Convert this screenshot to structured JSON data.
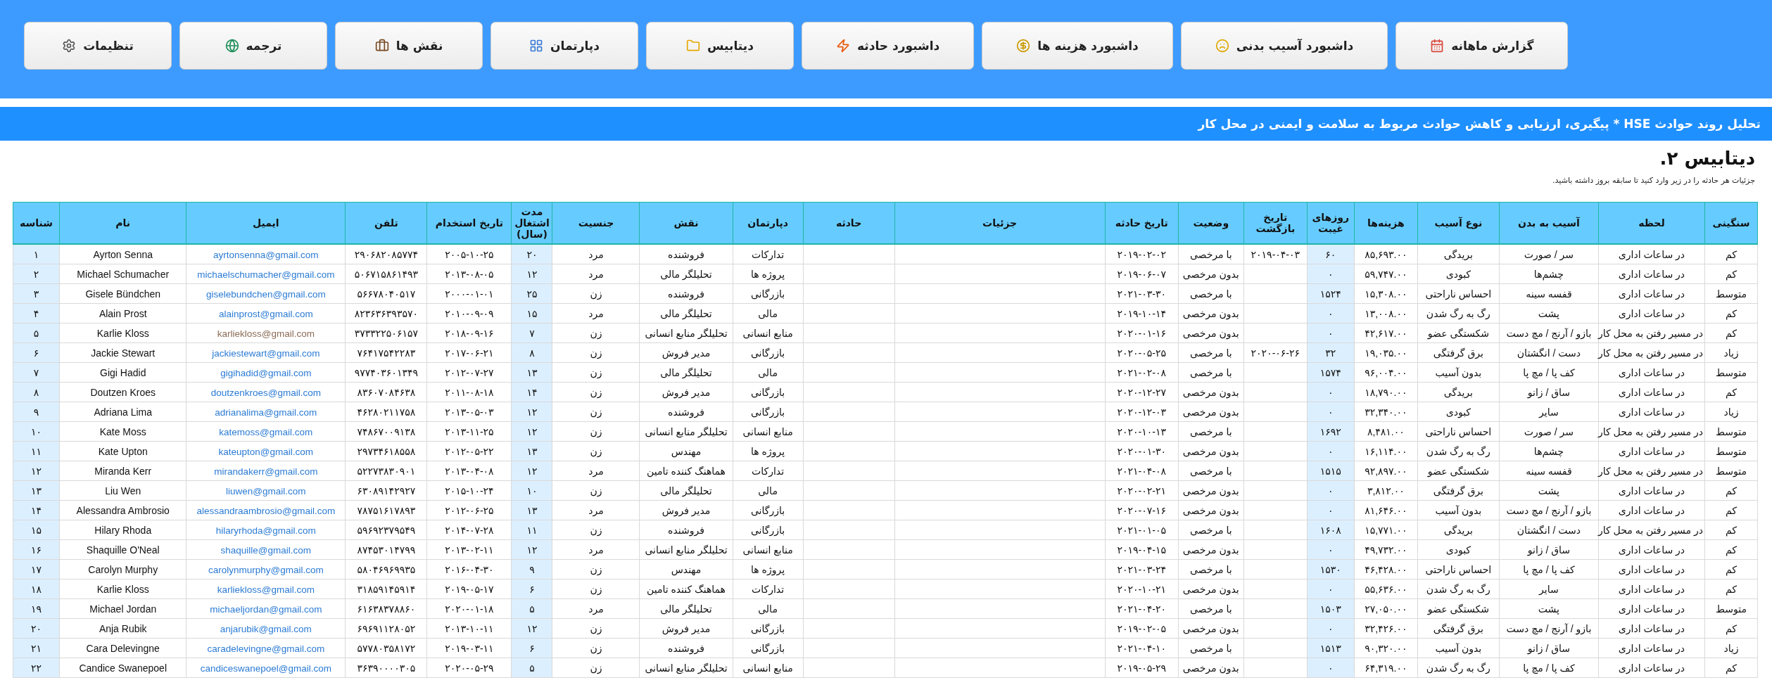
{
  "nav": [
    {
      "label": "گزارش ماهانه",
      "kind": "calendar"
    },
    {
      "label": "داشبورد آسیب بدنی",
      "kind": "sad"
    },
    {
      "label": "داشبورد هزینه ها",
      "kind": "money"
    },
    {
      "label": "داشبورد حادثه",
      "kind": "burst"
    },
    {
      "label": "دیتابیس",
      "kind": "folder"
    },
    {
      "label": "دپارتمان",
      "kind": "grid"
    },
    {
      "label": "نقش ها",
      "kind": "briefcase"
    },
    {
      "label": "ترجمه",
      "kind": "globe"
    },
    {
      "label": "تنظیمات",
      "kind": "gear"
    }
  ],
  "banner": "تحلیل روند حوادث HSE * پیگیری، ارزیابی و کاهش حوادث مربوط به سلامت و ایمنی در محل کار",
  "title": "دیتابیس ۲.",
  "subtitle": "جزئیات هر حادثه را در زیر وارد کنید تا سابقه بروز داشته باشید.",
  "table": {
    "columns": [
      {
        "label": "سنگینی"
      },
      {
        "label": "لحظه"
      },
      {
        "label": "آسیب به بدن"
      },
      {
        "label": "نوع آسیب"
      },
      {
        "label": "هزینه‌ها"
      },
      {
        "label": "روزهای غیبت"
      },
      {
        "label": "تاریخ بازگشت"
      },
      {
        "label": "وضعیت"
      },
      {
        "label": "تاریخ حادثه"
      },
      {
        "label": "جزئیات"
      },
      {
        "label": "حادثه"
      },
      {
        "label": "دپارتمان"
      },
      {
        "label": "نقش"
      },
      {
        "label": "جنسیت"
      },
      {
        "label": "مدت اشتغال (سال)"
      },
      {
        "label": "تاریخ استخدام"
      },
      {
        "label": "تلفن"
      },
      {
        "label": "ایمیل"
      },
      {
        "label": "نام"
      },
      {
        "label": "شناسه"
      }
    ],
    "rows": [
      {
        "severity": "کم",
        "moment": "در ساعات اداری",
        "body_part": "سر / صورت",
        "injury_type": "بریدگی",
        "cost": "۸۵,۶۹۳.۰۰",
        "days_absent": "۶۰",
        "return_date": "۲۰۱۹-۰۴-۰۳",
        "status": "با مرخصی",
        "incident_date": "۲۰۱۹-۰۲-۰۲",
        "department": "تدارکات",
        "role": "فروشنده",
        "gender": "مرد",
        "years": "۲۰",
        "hire_date": "۲۰۰۵-۱۰-۲۵",
        "phone": "۲۹۰۶۸۲۰۸۵۷۷۴",
        "email": "ayrtonsenna@gmail.com",
        "email_visited": false,
        "name": "Ayrton Senna",
        "id": "۱"
      },
      {
        "severity": "کم",
        "moment": "در ساعات اداری",
        "body_part": "چشم‌ها",
        "injury_type": "کبودی",
        "cost": "۵۹,۷۴۷.۰۰",
        "days_absent": "۰",
        "status": "بدون مرخصی",
        "incident_date": "۲۰۱۹-۰۶-۰۷",
        "department": "پروژه ها",
        "role": "تحلیلگر مالی",
        "gender": "مرد",
        "years": "۱۲",
        "hire_date": "۲۰۱۳-۰۸-۰۵",
        "phone": "۵۰۶۷۱۵۸۶۱۴۹۳",
        "email": "michaelschumacher@gmail.com",
        "email_visited": false,
        "name": "Michael Schumacher",
        "id": "۲"
      },
      {
        "severity": "متوسط",
        "moment": "در ساعات اداری",
        "body_part": "قفسه سینه",
        "injury_type": "احساس ناراحتی",
        "cost": "۱۵,۳۰۸.۰۰",
        "days_absent": "۱۵۲۴",
        "status": "با مرخصی",
        "incident_date": "۲۰۲۱-۰۳-۳۰",
        "department": "بازرگانی",
        "role": "فروشنده",
        "gender": "زن",
        "years": "۲۵",
        "hire_date": "۲۰۰۰-۰۱-۰۱",
        "phone": "۵۶۶۷۸۰۴۰۵۱۷",
        "email": "giselebundchen@gmail.com",
        "email_visited": false,
        "name": "Gisele Bündchen",
        "id": "۳"
      },
      {
        "severity": "کم",
        "moment": "در ساعات اداری",
        "body_part": "پشت",
        "injury_type": "رگ به رگ شدن",
        "cost": "۱۳,۰۰۸.۰۰",
        "days_absent": "۰",
        "status": "بدون مرخصی",
        "incident_date": "۲۰۱۹-۱۰-۱۴",
        "department": "مالی",
        "role": "تحلیلگر مالی",
        "gender": "مرد",
        "years": "۱۵",
        "hire_date": "۲۰۱۰-۰۹-۰۹",
        "phone": "۸۲۳۶۳۶۳۹۳۵۷۰",
        "email": "alainprost@gmail.com",
        "email_visited": false,
        "name": "Alain Prost",
        "id": "۴"
      },
      {
        "severity": "کم",
        "moment": "در مسیر رفتن به محل کار",
        "body_part": "بازو / آرنج / مچ دست",
        "injury_type": "شکستگی عضو",
        "cost": "۴۲,۶۱۷.۰۰",
        "days_absent": "۰",
        "status": "بدون مرخصی",
        "incident_date": "۲۰۲۰-۰۱-۱۶",
        "department": "منابع انسانی",
        "role": "تحلیلگر منابع انسانی",
        "gender": "زن",
        "years": "۷",
        "hire_date": "۲۰۱۸-۰۹-۱۶",
        "phone": "۳۷۳۳۲۲۵۰۶۱۵۷",
        "email": "karliekloss@gmail.com",
        "email_visited": true,
        "name": "Karlie Kloss",
        "id": "۵"
      },
      {
        "severity": "زیاد",
        "moment": "در مسیر رفتن به محل کار",
        "body_part": "دست / انگشتان",
        "injury_type": "برق گرفتگی",
        "cost": "۱۹,۰۳۵.۰۰",
        "days_absent": "۳۲",
        "return_date": "۲۰۲۰-۰۶-۲۶",
        "status": "با مرخصی",
        "incident_date": "۲۰۲۰-۰۵-۲۵",
        "department": "بازرگانی",
        "role": "مدیر فروش",
        "gender": "زن",
        "years": "۸",
        "hire_date": "۲۰۱۷-۰۶-۲۱",
        "phone": "۷۶۴۱۷۵۴۲۲۸۳",
        "email": "jackiestewart@gmail.com",
        "email_visited": false,
        "name": "Jackie Stewart",
        "id": "۶"
      },
      {
        "severity": "متوسط",
        "moment": "در ساعات اداری",
        "body_part": "کف پا / مچ پا",
        "injury_type": "بدون آسیب",
        "cost": "۹۶,۰۰۴.۰۰",
        "days_absent": "۱۵۷۴",
        "status": "با مرخصی",
        "incident_date": "۲۰۲۱-۰۲-۰۸",
        "department": "مالی",
        "role": "تحلیلگر مالی",
        "gender": "زن",
        "years": "۱۳",
        "hire_date": "۲۰۱۲-۰۷-۲۷",
        "phone": "۹۷۷۴۰۳۶۰۱۳۴۹",
        "email": "gigihadid@gmail.com",
        "email_visited": false,
        "name": "Gigi Hadid",
        "id": "۷"
      },
      {
        "severity": "کم",
        "moment": "در ساعات اداری",
        "body_part": "ساق / زانو",
        "injury_type": "بریدگی",
        "cost": "۱۸,۷۹۰.۰۰",
        "days_absent": "۰",
        "status": "بدون مرخصی",
        "incident_date": "۲۰۲۰-۱۲-۲۷",
        "department": "بازرگانی",
        "role": "مدیر فروش",
        "gender": "زن",
        "years": "۱۴",
        "hire_date": "۲۰۱۱-۰۸-۱۸",
        "phone": "۸۳۶۰۷۰۸۴۶۳۸",
        "email": "doutzenkroes@gmail.com",
        "email_visited": false,
        "name": "Doutzen Kroes",
        "id": "۸"
      },
      {
        "severity": "زیاد",
        "moment": "در ساعات اداری",
        "body_part": "سایر",
        "injury_type": "کبودی",
        "cost": "۳۲,۳۴۰.۰۰",
        "days_absent": "۰",
        "status": "بدون مرخصی",
        "incident_date": "۲۰۲۰-۱۲-۰۳",
        "department": "بازرگانی",
        "role": "فروشنده",
        "gender": "زن",
        "years": "۱۲",
        "hire_date": "۲۰۱۳-۰۵-۰۳",
        "phone": "۴۶۲۸۰۲۱۱۷۵۸",
        "email": "adrianalima@gmail.com",
        "email_visited": false,
        "name": "Adriana Lima",
        "id": "۹"
      },
      {
        "severity": "متوسط",
        "moment": "در مسیر رفتن به محل کار",
        "body_part": "سر / صورت",
        "injury_type": "احساس ناراحتی",
        "cost": "۸,۴۸۱.۰۰",
        "days_absent": "۱۶۹۲",
        "status": "با مرخصی",
        "incident_date": "۲۰۲۰-۱۰-۱۳",
        "department": "منابع انسانی",
        "role": "تحلیلگر منابع انسانی",
        "gender": "زن",
        "years": "۱۲",
        "hire_date": "۲۰۱۳-۱۱-۲۵",
        "phone": "۷۴۸۶۷۰۰۹۱۳۸",
        "email": "katemoss@gmail.com",
        "email_visited": false,
        "name": "Kate Moss",
        "id": "۱۰"
      },
      {
        "severity": "متوسط",
        "moment": "در ساعات اداری",
        "body_part": "چشم‌ها",
        "injury_type": "رگ به رگ شدن",
        "cost": "۱۶,۱۱۴.۰۰",
        "days_absent": "۰",
        "status": "بدون مرخصی",
        "incident_date": "۲۰۲۰-۰۱-۳۰",
        "department": "پروژه ها",
        "role": "مهندس",
        "gender": "زن",
        "years": "۱۳",
        "hire_date": "۲۰۱۲-۰۵-۲۲",
        "phone": "۲۹۷۳۴۶۱۸۵۵۸",
        "email": "kateupton@gmail.com",
        "email_visited": false,
        "name": "Kate Upton",
        "id": "۱۱"
      },
      {
        "severity": "متوسط",
        "moment": "در مسیر رفتن به محل کار",
        "body_part": "قفسه سینه",
        "injury_type": "شکستگی عضو",
        "cost": "۹۲,۸۹۷.۰۰",
        "days_absent": "۱۵۱۵",
        "status": "با مرخصی",
        "incident_date": "۲۰۲۱-۰۴-۰۸",
        "department": "تدارکات",
        "role": "هماهنگ کننده تامین",
        "gender": "مرد",
        "years": "۱۲",
        "hire_date": "۲۰۱۳-۰۴-۰۸",
        "phone": "۵۲۲۷۳۸۳۰۹۰۱",
        "email": "mirandakerr@gmail.com",
        "email_visited": false,
        "name": "Miranda Kerr",
        "id": "۱۲"
      },
      {
        "severity": "کم",
        "moment": "در ساعات اداری",
        "body_part": "پشت",
        "injury_type": "برق گرفتگی",
        "cost": "۳,۸۱۲.۰۰",
        "days_absent": "۰",
        "status": "بدون مرخصی",
        "incident_date": "۲۰۲۰-۰۲-۲۱",
        "department": "مالی",
        "role": "تحلیلگر مالی",
        "gender": "زن",
        "years": "۱۰",
        "hire_date": "۲۰۱۵-۱۰-۲۴",
        "phone": "۶۳۰۸۹۱۴۲۹۲۷",
        "email": "liuwen@gmail.com",
        "email_visited": false,
        "name": "Liu Wen",
        "id": "۱۳"
      },
      {
        "severity": "کم",
        "moment": "در ساعات اداری",
        "body_part": "بازو / آرنج / مچ دست",
        "injury_type": "بدون آسیب",
        "cost": "۸۱,۶۴۶.۰۰",
        "days_absent": "۰",
        "status": "بدون مرخصی",
        "incident_date": "۲۰۲۰-۰۷-۱۶",
        "department": "بازرگانی",
        "role": "مدیر فروش",
        "gender": "مرد",
        "years": "۱۳",
        "hire_date": "۲۰۱۲-۰۶-۲۵",
        "phone": "۷۸۷۵۱۶۱۷۸۹۳",
        "email": "alessandraambrosio@gmail.com",
        "email_visited": false,
        "name": "Alessandra Ambrosio",
        "id": "۱۴"
      },
      {
        "severity": "کم",
        "moment": "در مسیر رفتن به محل کار",
        "body_part": "دست / انگشتان",
        "injury_type": "بریدگی",
        "cost": "۱۵,۷۷۱.۰۰",
        "days_absent": "۱۶۰۸",
        "status": "با مرخصی",
        "incident_date": "۲۰۲۱-۰۱-۰۵",
        "department": "بازرگانی",
        "role": "فروشنده",
        "gender": "زن",
        "years": "۱۱",
        "hire_date": "۲۰۱۴-۰۷-۲۸",
        "phone": "۵۹۶۹۲۳۷۹۵۴۹",
        "email": "hilaryrhoda@gmail.com",
        "email_visited": false,
        "name": "Hilary Rhoda",
        "id": "۱۵"
      },
      {
        "severity": "کم",
        "moment": "در ساعات اداری",
        "body_part": "ساق / زانو",
        "injury_type": "کبودی",
        "cost": "۴۹,۷۳۲.۰۰",
        "days_absent": "۰",
        "status": "بدون مرخصی",
        "incident_date": "۲۰۱۹-۰۴-۱۵",
        "department": "منابع انسانی",
        "role": "تحلیلگر منابع انسانی",
        "gender": "مرد",
        "years": "۱۲",
        "hire_date": "۲۰۱۳-۰۲-۱۱",
        "phone": "۸۷۴۵۳۰۱۴۷۹۹",
        "email": "shaquille@gmail.com",
        "email_visited": false,
        "name": "Shaquille O'Neal",
        "id": "۱۶"
      },
      {
        "severity": "کم",
        "moment": "در ساعات اداری",
        "body_part": "کف پا / مچ پا",
        "injury_type": "احساس ناراحتی",
        "cost": "۴۶,۴۲۸.۰۰",
        "days_absent": "۱۵۳۰",
        "status": "با مرخصی",
        "incident_date": "۲۰۲۱-۰۳-۲۴",
        "department": "پروژه ها",
        "role": "مهندس",
        "gender": "زن",
        "years": "۹",
        "hire_date": "۲۰۱۶-۰۴-۳۰",
        "phone": "۵۸۰۴۶۹۶۹۹۳۵",
        "email": "carolynmurphy@gmail.com",
        "email_visited": false,
        "name": "Carolyn Murphy",
        "id": "۱۷"
      },
      {
        "severity": "کم",
        "moment": "در ساعات اداری",
        "body_part": "سایر",
        "injury_type": "رگ به رگ شدن",
        "cost": "۵۵,۶۳۶.۰۰",
        "days_absent": "۰",
        "status": "بدون مرخصی",
        "incident_date": "۲۰۲۰-۱۰-۲۱",
        "department": "تدارکات",
        "role": "هماهنگ کننده تامین",
        "gender": "زن",
        "years": "۶",
        "hire_date": "۲۰۱۹-۰۵-۱۷",
        "phone": "۳۱۸۵۹۱۴۵۹۱۴",
        "email": "karliekloss@gmail.com",
        "email_visited": false,
        "name": "Karlie Kloss",
        "id": "۱۸"
      },
      {
        "severity": "متوسط",
        "moment": "در ساعات اداری",
        "body_part": "پشت",
        "injury_type": "شکستگی عضو",
        "cost": "۲۷,۰۵۰.۰۰",
        "days_absent": "۱۵۰۳",
        "status": "با مرخصی",
        "incident_date": "۲۰۲۱-۰۴-۲۰",
        "department": "مالی",
        "role": "تحلیلگر مالی",
        "gender": "مرد",
        "years": "۵",
        "hire_date": "۲۰۲۰-۰۱-۱۸",
        "phone": "۶۱۶۳۸۳۷۸۸۶۰",
        "email": "michaeljordan@gmail.com",
        "email_visited": false,
        "name": "Michael Jordan",
        "id": "۱۹"
      },
      {
        "severity": "کم",
        "moment": "در ساعات اداری",
        "body_part": "بازو / آرنج / مچ دست",
        "injury_type": "برق گرفتگی",
        "cost": "۳۲,۴۲۶.۰۰",
        "days_absent": "۰",
        "status": "بدون مرخصی",
        "incident_date": "۲۰۱۹-۰۲-۰۵",
        "department": "بازرگانی",
        "role": "مدیر فروش",
        "gender": "زن",
        "years": "۱۲",
        "hire_date": "۲۰۱۳-۱۰-۱۱",
        "phone": "۶۹۶۹۱۱۲۸۰۵۲",
        "email": "anjarubik@gmail.com",
        "email_visited": false,
        "name": "Anja Rubik",
        "id": "۲۰"
      },
      {
        "severity": "زیاد",
        "moment": "در ساعات اداری",
        "body_part": "ساق / زانو",
        "injury_type": "بدون آسیب",
        "cost": "۹۰,۳۲۰.۰۰",
        "days_absent": "۱۵۱۳",
        "status": "با مرخصی",
        "incident_date": "۲۰۲۱-۰۴-۱۰",
        "department": "بازرگانی",
        "role": "فروشنده",
        "gender": "زن",
        "years": "۶",
        "hire_date": "۲۰۱۹-۰۳-۱۱",
        "phone": "۵۷۷۸۰۳۵۸۱۷۲",
        "email": "caradelevingne@gmail.com",
        "email_visited": false,
        "name": "Cara Delevingne",
        "id": "۲۱"
      },
      {
        "severity": "کم",
        "moment": "در ساعات اداری",
        "body_part": "کف پا / مچ پا",
        "injury_type": "رگ به رگ شدن",
        "cost": "۶۴,۳۱۹.۰۰",
        "days_absent": "۰",
        "status": "بدون مرخصی",
        "incident_date": "۲۰۱۹-۰۵-۲۹",
        "department": "منابع انسانی",
        "role": "تحلیلگر منابع انسانی",
        "gender": "زن",
        "years": "۵",
        "hire_date": "۲۰۲۰-۰۵-۲۹",
        "phone": "۳۶۳۹۰۰۰۰۳۰۵",
        "email": "candiceswanepoel@gmail.com",
        "email_visited": false,
        "name": "Candice Swanepoel",
        "id": "۲۲"
      }
    ]
  }
}
